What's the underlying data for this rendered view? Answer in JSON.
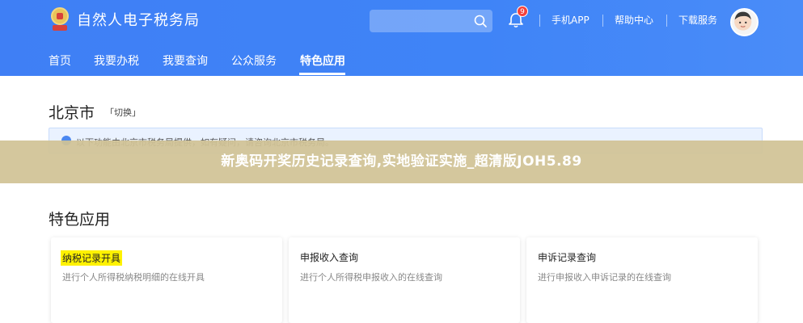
{
  "header": {
    "title": "自然人电子税务局",
    "notification_count": "9",
    "links": [
      "手机APP",
      "帮助中心",
      "下载服务"
    ]
  },
  "nav": {
    "items": [
      "首页",
      "我要办税",
      "我要查询",
      "公众服务",
      "特色应用"
    ],
    "active": "特色应用"
  },
  "location": {
    "city": "北京市",
    "switch_label": "「切换」"
  },
  "notice": {
    "text": "以下功能由北京市税务局提供，如有疑问，请咨询北京市税务局。"
  },
  "overlay": {
    "text": "新奥码开奖历史记录查询,实地验证实施_超清版JOH5.89"
  },
  "section": {
    "title": "特色应用",
    "cards": [
      {
        "title": "纳税记录开具",
        "desc": "进行个人所得税纳税明细的在线开具",
        "highlighted": true
      },
      {
        "title": "申报收入查询",
        "desc": "进行个人所得税申报收入的在线查询",
        "highlighted": false
      },
      {
        "title": "申诉记录查询",
        "desc": "进行申报收入申诉记录的在线查询",
        "highlighted": false
      }
    ]
  },
  "colors": {
    "header_blue": "#3f84f7",
    "badge_red": "#f5413c",
    "highlight_yellow": "#fff200",
    "notice_bg": "#eaf2ff"
  }
}
